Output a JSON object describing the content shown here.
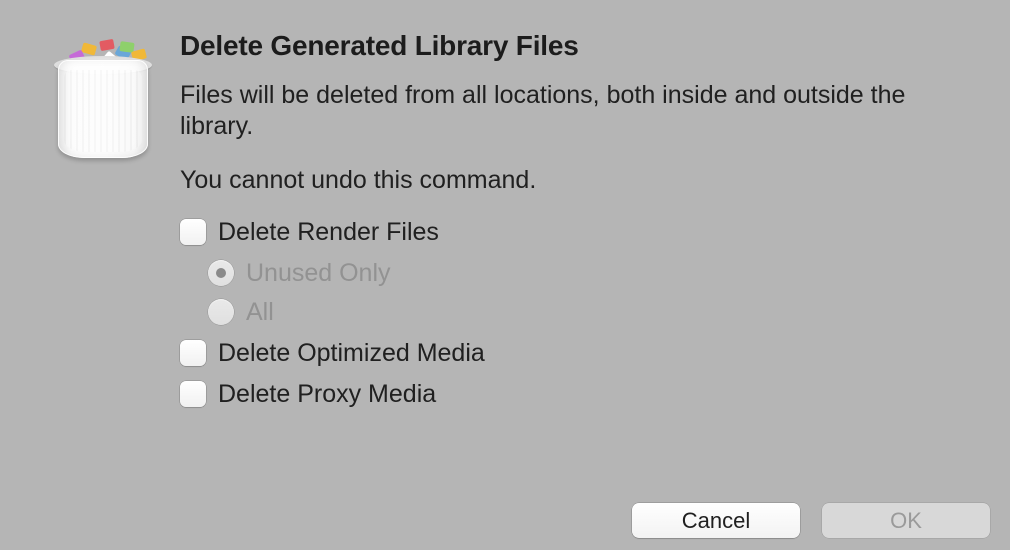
{
  "title": "Delete Generated Library Files",
  "description": "Files will be deleted from all locations, both inside and outside the library.",
  "warning": "You cannot undo this command.",
  "options": {
    "delete_render_files": {
      "label": "Delete Render Files",
      "checked": false
    },
    "render_scope": {
      "unused_only": {
        "label": "Unused Only",
        "selected": true,
        "disabled": true
      },
      "all": {
        "label": "All",
        "selected": false,
        "disabled": true
      }
    },
    "delete_optimized_media": {
      "label": "Delete Optimized Media",
      "checked": false
    },
    "delete_proxy_media": {
      "label": "Delete Proxy Media",
      "checked": false
    }
  },
  "buttons": {
    "cancel": "Cancel",
    "ok": "OK"
  }
}
